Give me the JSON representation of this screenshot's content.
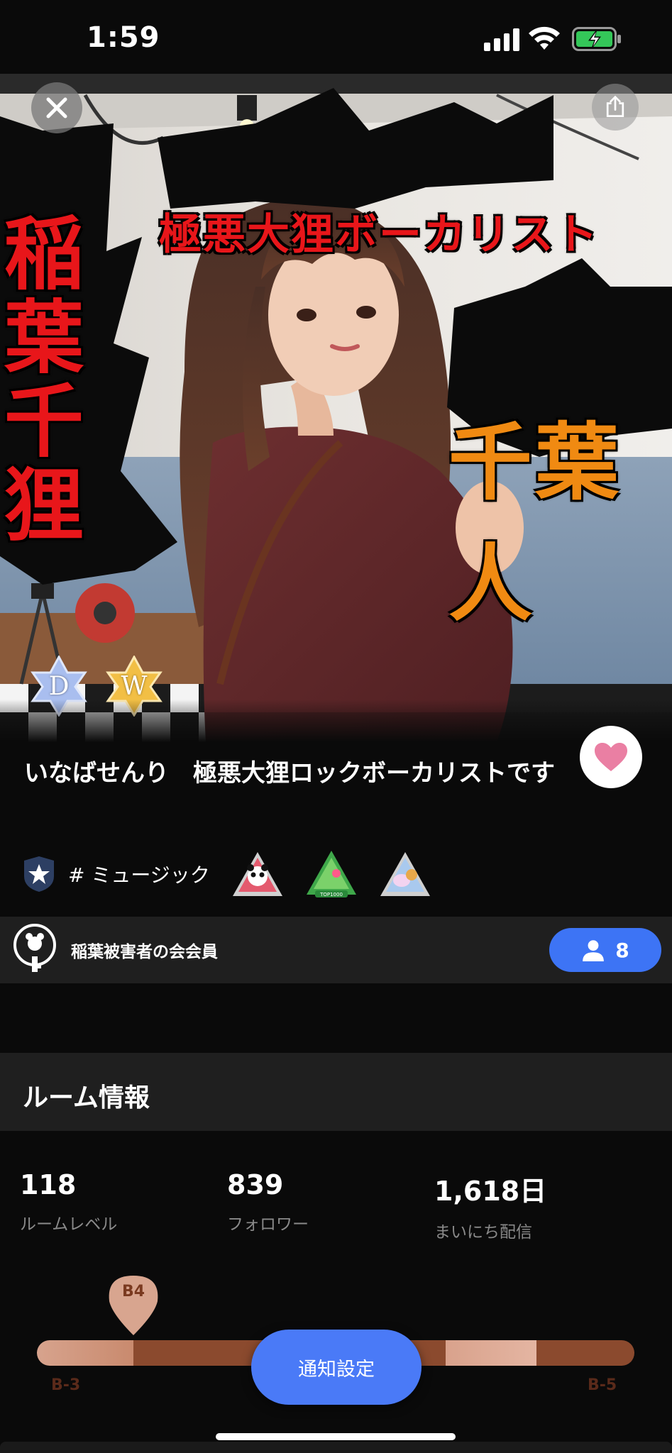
{
  "status_bar": {
    "time": "1:59"
  },
  "hero": {
    "captions": {
      "left": "稲葉千狸",
      "top": "極悪大狸ボーカリスト",
      "right": "千葉人"
    },
    "badges": [
      {
        "letter": "D",
        "color": "#9fb6ef"
      },
      {
        "letter": "W",
        "color": "#f2bf45"
      }
    ]
  },
  "room": {
    "title": "いなばせんり　極悪大狸ロックボーカリストです",
    "genre": "# ミュージック",
    "achievement_badges": [
      "panda-badge-icon",
      "top1000-badge-icon",
      "unicorn-badge-icon"
    ]
  },
  "fan_club": {
    "label": "稲葉被害者の会会員",
    "member_count": "8"
  },
  "room_info": {
    "title": "ルーム情報",
    "stats": [
      {
        "value": "118",
        "label": "ルームレベル"
      },
      {
        "value": "839",
        "label": "フォロワー"
      },
      {
        "value": "1,618日",
        "label": "まいにち配信"
      }
    ],
    "rank": {
      "current": "B4",
      "left_tick": "B-3",
      "right_tick": "B-5",
      "progress": 0.16
    },
    "notify_button": "通知設定"
  },
  "colors": {
    "accent_blue": "#3d74f5",
    "heart_pink": "#ea7fa3",
    "caption_red": "#e8161a",
    "caption_orange": "#f08a12"
  }
}
